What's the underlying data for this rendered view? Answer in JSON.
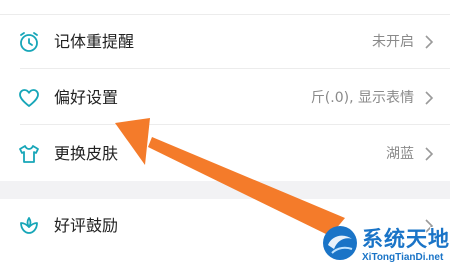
{
  "settings": {
    "items": [
      {
        "label": "记体重提醒",
        "value": "未开启",
        "icon": "alarm-clock-icon"
      },
      {
        "label": "偏好设置",
        "value": "斤(.0), 显示表情",
        "icon": "heart-icon"
      },
      {
        "label": "更换皮肤",
        "value": "湖蓝",
        "icon": "tshirt-icon"
      },
      {
        "label": "好评鼓励",
        "value": "",
        "icon": "flower-icon"
      }
    ]
  },
  "colors": {
    "icon_accent": "#17a6b8",
    "arrow": "#f47b2a",
    "watermark": "#1a74c7",
    "background": "#f2f2f4"
  },
  "watermark": {
    "title": "系统天地",
    "url": "XiTongTianDi.net"
  }
}
